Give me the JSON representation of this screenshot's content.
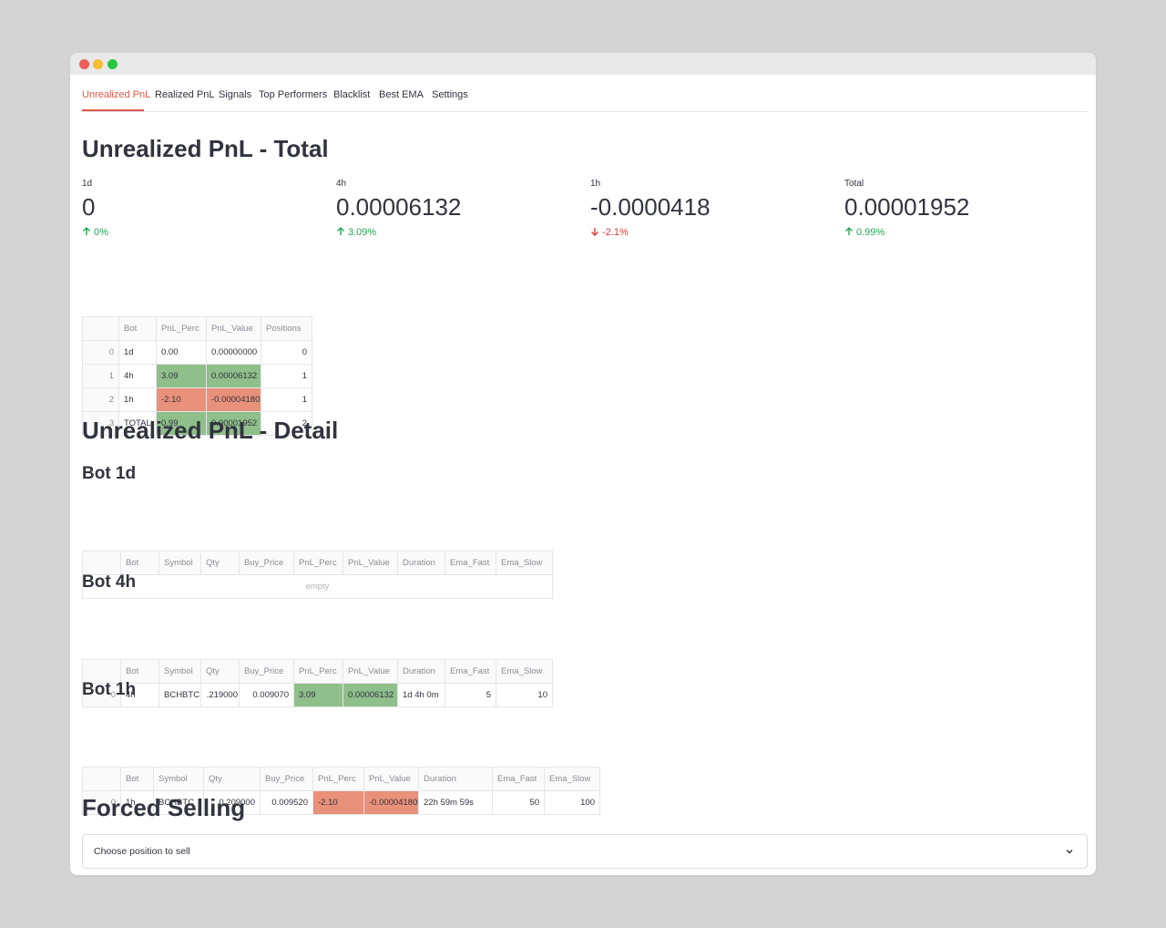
{
  "tabs": [
    "Unrealized PnL",
    "Realized PnL",
    "Signals",
    "Top Performers",
    "Blacklist",
    "Best EMA",
    "Settings"
  ],
  "active_tab": "Unrealized PnL",
  "total_section": {
    "title": "Unrealized PnL - Total",
    "metrics": [
      {
        "label": "1d",
        "value": "0",
        "delta": "0%",
        "direction": "up"
      },
      {
        "label": "4h",
        "value": "0.00006132",
        "delta": "3.09%",
        "direction": "up"
      },
      {
        "label": "1h",
        "value": "-0.0000418",
        "delta": "-2.1%",
        "direction": "down"
      },
      {
        "label": "Total",
        "value": "0.00001952",
        "delta": "0.99%",
        "direction": "up"
      }
    ],
    "table": {
      "columns": [
        "",
        "Bot",
        "PnL_Perc",
        "PnL_Value",
        "Positions"
      ],
      "rows": [
        [
          "0",
          "1d",
          "0.00",
          "0.00000000",
          "0"
        ],
        [
          "1",
          "4h",
          "3.09",
          "0.00006132",
          "1"
        ],
        [
          "2",
          "1h",
          "-2.10",
          "-0.00004180",
          "1"
        ],
        [
          "3",
          "TOTAL",
          "0.99",
          "0.00001952",
          "2"
        ]
      ]
    }
  },
  "detail_section": {
    "title": "Unrealized PnL - Detail",
    "bot_1d": {
      "title": "Bot 1d",
      "columns": [
        "",
        "Bot",
        "Symbol",
        "Qty",
        "Buy_Price",
        "PnL_Perc",
        "PnL_Value",
        "Duration",
        "Ema_Fast",
        "Ema_Slow"
      ],
      "empty_text": "empty"
    },
    "bot_4h": {
      "title": "Bot 4h",
      "columns": [
        "",
        "Bot",
        "Symbol",
        "Qty",
        "Buy_Price",
        "PnL_Perc",
        "PnL_Value",
        "Duration",
        "Ema_Fast",
        "Ema_Slow"
      ],
      "rows": [
        [
          "0",
          "4h",
          "BCHBTC",
          ".219000",
          "0.009070",
          "3.09",
          "0.00006132",
          "1d 4h 0m",
          "5",
          "10"
        ]
      ]
    },
    "bot_1h": {
      "title": "Bot 1h",
      "columns": [
        "",
        "Bot",
        "Symbol",
        "Qty",
        "Buy_Price",
        "PnL_Perc",
        "PnL_Value",
        "Duration",
        "Ema_Fast",
        "Ema_Slow"
      ],
      "rows": [
        [
          "0",
          "1h",
          "BCHBTC",
          "0.209000",
          "0.009520",
          "-2.10",
          "-0.00004180",
          "22h 59m 59s",
          "50",
          "100"
        ]
      ]
    }
  },
  "forced_selling": {
    "title": "Forced Selling",
    "placeholder": "Choose position to sell",
    "chevron_icon": "chevron-down-icon"
  },
  "colors": {
    "accent": "#e0584b",
    "positive_cell": "#8fbf8a",
    "negative_cell": "#e9917a",
    "delta_up": "#21a651",
    "delta_down": "#e03a36"
  }
}
